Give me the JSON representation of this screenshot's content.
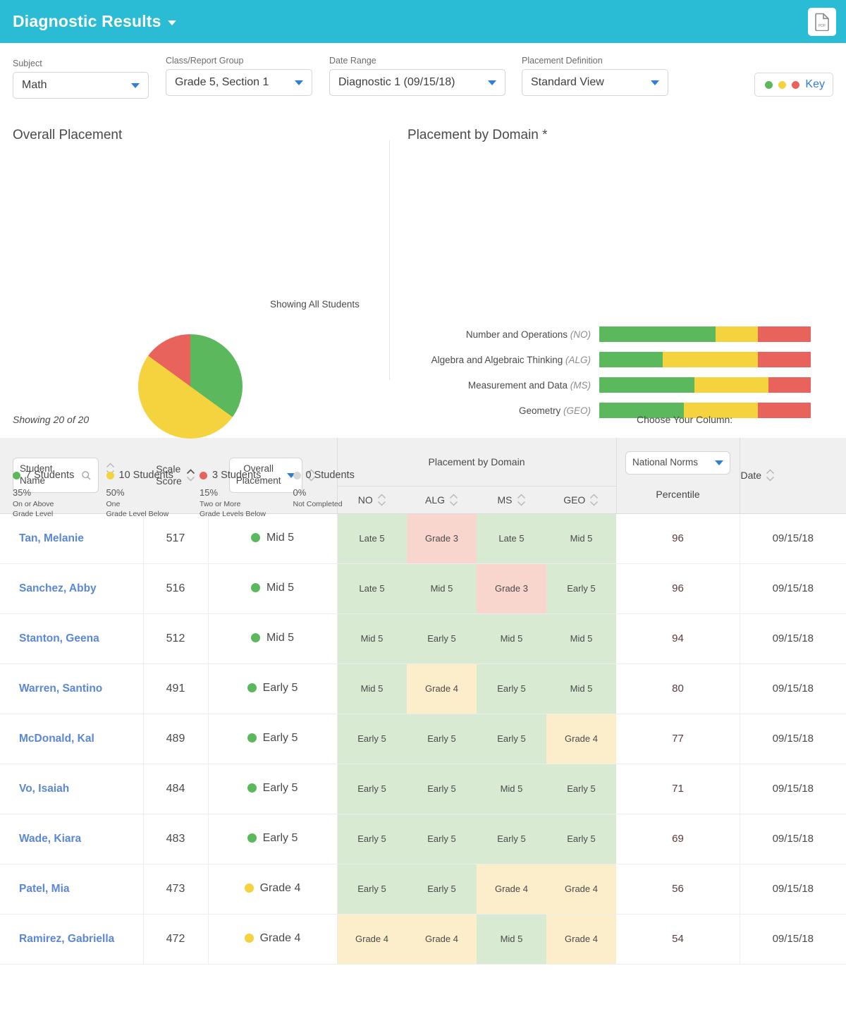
{
  "header": {
    "title": "Diagnostic Results",
    "dropdown_icon": "caret-down-icon",
    "pdf_label": "PDF",
    "pdf_icon": "pdf-document-icon"
  },
  "filters": [
    {
      "label": "Subject",
      "value": "Math"
    },
    {
      "label": "Class/Report Group",
      "value": "Grade 5, Section 1"
    },
    {
      "label": "Date Range",
      "value": "Diagnostic 1 (09/15/18)"
    },
    {
      "label": "Placement Definition",
      "value": "Standard View"
    }
  ],
  "key_button": {
    "label": "Key",
    "dots": [
      "#5cb85c",
      "#f5d33f",
      "#e8635c"
    ]
  },
  "colors": {
    "brand_teal": "#29bcd4",
    "green": "#5cb85c",
    "yellow": "#f5d33f",
    "red": "#e8635c",
    "gray": "#d8d8d8",
    "link_blue": "#5b87d8",
    "cell_green": "#d9ead3",
    "cell_yellow": "#fdeecb",
    "cell_red": "#f8d5cd"
  },
  "overall_placement": {
    "title": "Overall Placement",
    "showing": "Showing All Students",
    "legend": [
      {
        "count": "7 Students",
        "pct": "35%",
        "desc": "On or Above\nGrade Level",
        "color": "#5cb85c"
      },
      {
        "count": "10 Students",
        "pct": "50%",
        "desc": "One\nGrade Level Below",
        "color": "#f5d33f"
      },
      {
        "count": "3 Students",
        "pct": "15%",
        "desc": "Two or More\nGrade Levels Below",
        "color": "#e8635c"
      },
      {
        "count": "0 Students",
        "pct": "0%",
        "desc": "Not Completed",
        "color": "#d8d8d8"
      }
    ]
  },
  "placement_by_domain": {
    "title": "Placement by Domain *"
  },
  "chart_data": [
    {
      "type": "pie",
      "title": "Overall Placement",
      "subtitle": "Showing All Students",
      "labels": [
        "On or Above Grade Level",
        "One Grade Level Below",
        "Two or More Grade Levels Below",
        "Not Completed"
      ],
      "values": [
        35,
        50,
        15,
        0
      ],
      "counts": [
        7,
        10,
        3,
        0
      ],
      "colors": [
        "#5cb85c",
        "#f5d33f",
        "#e8635c",
        "#d8d8d8"
      ],
      "legend": "bottom",
      "start_angle": 0
    },
    {
      "type": "bar",
      "orientation": "horizontal",
      "stacked": true,
      "title": "Placement by Domain *",
      "categories": [
        "Number and Operations (NO)",
        "Algebra and Algebraic Thinking (ALG)",
        "Measurement and Data (MS)",
        "Geometry (GEO)"
      ],
      "series": [
        {
          "name": "On or Above Grade Level",
          "color": "#5cb85c",
          "values": [
            55,
            30,
            45,
            40
          ]
        },
        {
          "name": "One Grade Level Below",
          "color": "#f5d33f",
          "values": [
            20,
            45,
            35,
            35
          ]
        },
        {
          "name": "Two or More Grade Levels Below",
          "color": "#e8635c",
          "values": [
            25,
            25,
            20,
            25
          ]
        }
      ],
      "xlim": [
        0,
        100
      ],
      "grid": false,
      "legend": "none"
    }
  ],
  "table": {
    "showing_count": "Showing 20 of 20",
    "choose_your_column": "Choose Your Column:",
    "student_name_field": "Student\nName",
    "student_name_placeholder": "Student Name",
    "scale_score_label": "Scale\nScore",
    "overall_placement_select": "Overall\nPlacement",
    "group_header": "Placement by Domain",
    "domain_columns": [
      "NO",
      "ALG",
      "MS",
      "GEO"
    ],
    "norms_select": "National Norms",
    "percentile_label": "Percentile",
    "date_label": "Date",
    "rows": [
      {
        "name": "Tan, Melanie",
        "score": "517",
        "overall": "Mid 5",
        "overall_color": "#5cb85c",
        "domains": [
          {
            "v": "Late 5",
            "s": "green"
          },
          {
            "v": "Grade 3",
            "s": "red"
          },
          {
            "v": "Late 5",
            "s": "green"
          },
          {
            "v": "Mid 5",
            "s": "green"
          }
        ],
        "percentile": "96",
        "date": "09/15/18"
      },
      {
        "name": "Sanchez, Abby",
        "score": "516",
        "overall": "Mid 5",
        "overall_color": "#5cb85c",
        "domains": [
          {
            "v": "Late 5",
            "s": "green"
          },
          {
            "v": "Mid 5",
            "s": "green"
          },
          {
            "v": "Grade 3",
            "s": "red"
          },
          {
            "v": "Early 5",
            "s": "green"
          }
        ],
        "percentile": "96",
        "date": "09/15/18"
      },
      {
        "name": "Stanton, Geena",
        "score": "512",
        "overall": "Mid 5",
        "overall_color": "#5cb85c",
        "domains": [
          {
            "v": "Mid 5",
            "s": "green"
          },
          {
            "v": "Early 5",
            "s": "green"
          },
          {
            "v": "Mid 5",
            "s": "green"
          },
          {
            "v": "Mid 5",
            "s": "green"
          }
        ],
        "percentile": "94",
        "date": "09/15/18"
      },
      {
        "name": "Warren, Santino",
        "score": "491",
        "overall": "Early 5",
        "overall_color": "#5cb85c",
        "domains": [
          {
            "v": "Mid 5",
            "s": "green"
          },
          {
            "v": "Grade 4",
            "s": "yellow"
          },
          {
            "v": "Early 5",
            "s": "green"
          },
          {
            "v": "Mid 5",
            "s": "green"
          }
        ],
        "percentile": "80",
        "date": "09/15/18"
      },
      {
        "name": "McDonald, Kal",
        "score": "489",
        "overall": "Early 5",
        "overall_color": "#5cb85c",
        "domains": [
          {
            "v": "Early 5",
            "s": "green"
          },
          {
            "v": "Early 5",
            "s": "green"
          },
          {
            "v": "Early 5",
            "s": "green"
          },
          {
            "v": "Grade 4",
            "s": "yellow"
          }
        ],
        "percentile": "77",
        "date": "09/15/18"
      },
      {
        "name": "Vo, Isaiah",
        "score": "484",
        "overall": "Early 5",
        "overall_color": "#5cb85c",
        "domains": [
          {
            "v": "Early 5",
            "s": "green"
          },
          {
            "v": "Early 5",
            "s": "green"
          },
          {
            "v": "Mid 5",
            "s": "green"
          },
          {
            "v": "Early 5",
            "s": "green"
          }
        ],
        "percentile": "71",
        "date": "09/15/18"
      },
      {
        "name": "Wade, Kiara",
        "score": "483",
        "overall": "Early 5",
        "overall_color": "#5cb85c",
        "domains": [
          {
            "v": "Early 5",
            "s": "green"
          },
          {
            "v": "Early 5",
            "s": "green"
          },
          {
            "v": "Early 5",
            "s": "green"
          },
          {
            "v": "Early 5",
            "s": "green"
          }
        ],
        "percentile": "69",
        "date": "09/15/18"
      },
      {
        "name": "Patel, Mia",
        "score": "473",
        "overall": "Grade 4",
        "overall_color": "#f5d33f",
        "domains": [
          {
            "v": "Early 5",
            "s": "green"
          },
          {
            "v": "Early 5",
            "s": "green"
          },
          {
            "v": "Grade 4",
            "s": "yellow"
          },
          {
            "v": "Grade 4",
            "s": "yellow"
          }
        ],
        "percentile": "56",
        "date": "09/15/18"
      },
      {
        "name": "Ramirez, Gabriella",
        "score": "472",
        "overall": "Grade 4",
        "overall_color": "#f5d33f",
        "domains": [
          {
            "v": "Grade 4",
            "s": "yellow"
          },
          {
            "v": "Grade 4",
            "s": "yellow"
          },
          {
            "v": "Mid 5",
            "s": "green"
          },
          {
            "v": "Grade 4",
            "s": "yellow"
          }
        ],
        "percentile": "54",
        "date": "09/15/18"
      }
    ]
  }
}
